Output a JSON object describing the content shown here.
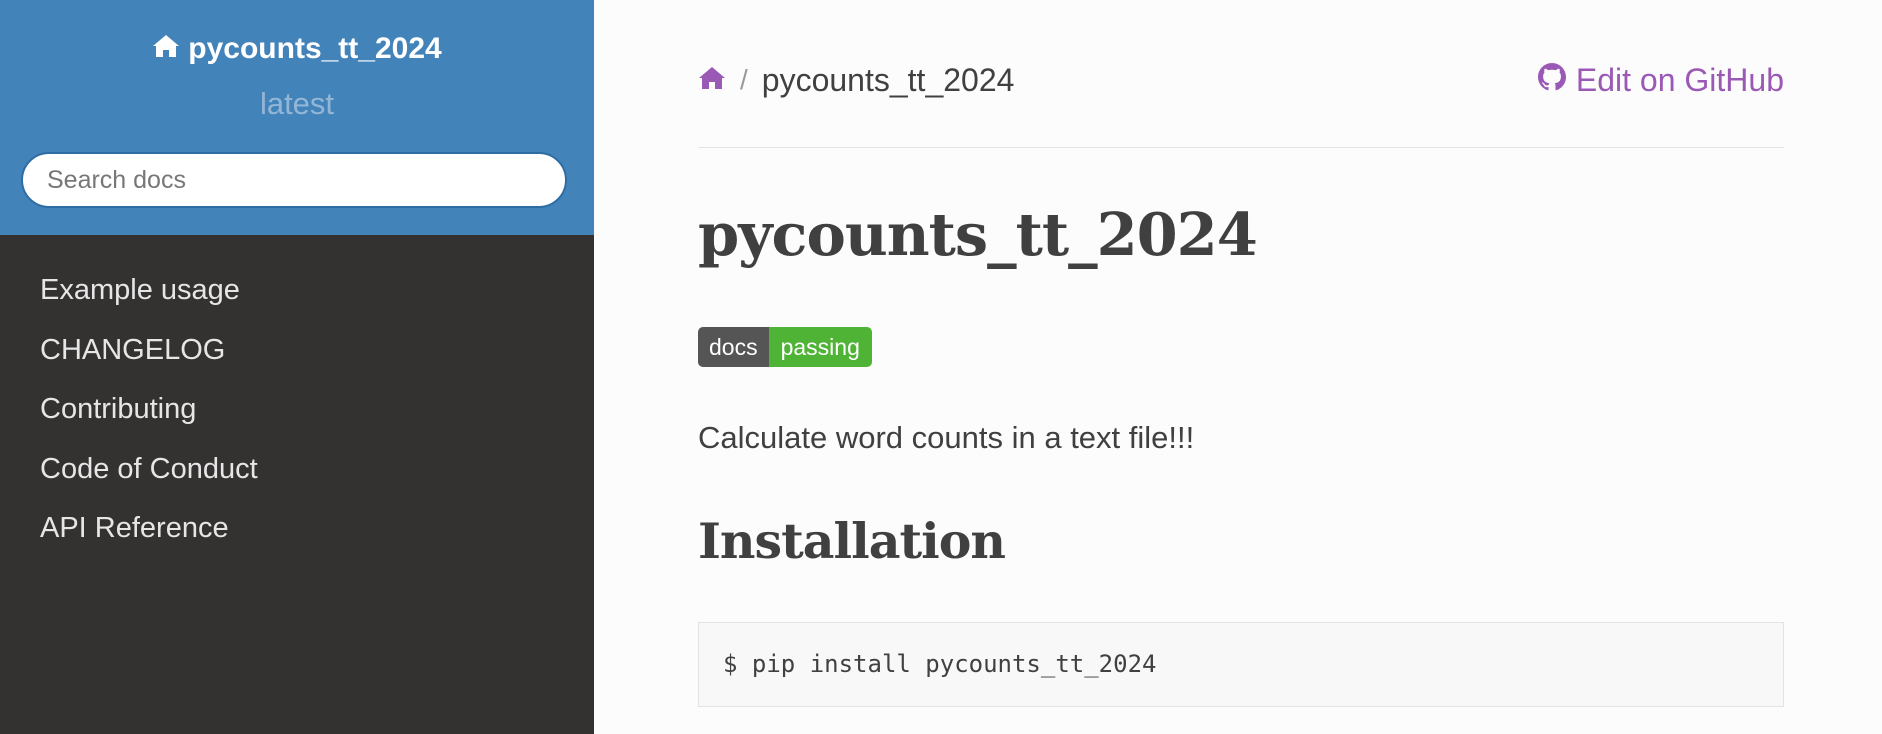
{
  "sidebar": {
    "project_name": "pycounts_tt_2024",
    "version": "latest",
    "search_placeholder": "Search docs",
    "nav_items": [
      {
        "label": "Example usage"
      },
      {
        "label": "CHANGELOG"
      },
      {
        "label": "Contributing"
      },
      {
        "label": "Code of Conduct"
      },
      {
        "label": "API Reference"
      }
    ]
  },
  "breadcrumbs": {
    "current": "pycounts_tt_2024",
    "separator": "/",
    "edit_link": "Edit on GitHub"
  },
  "main": {
    "title": "pycounts_tt_2024",
    "badge": {
      "left": "docs",
      "right": "passing"
    },
    "description": "Calculate word counts in a text file!!!",
    "section_heading": "Installation",
    "code": "$ pip install pycounts_tt_2024"
  },
  "colors": {
    "sidebar_header": "#4283b9",
    "sidebar_body": "#343131",
    "link_purple": "#9b59b6",
    "badge_green": "#4fb335",
    "badge_gray": "#555555"
  },
  "icons": [
    "home-icon",
    "github-icon"
  ]
}
